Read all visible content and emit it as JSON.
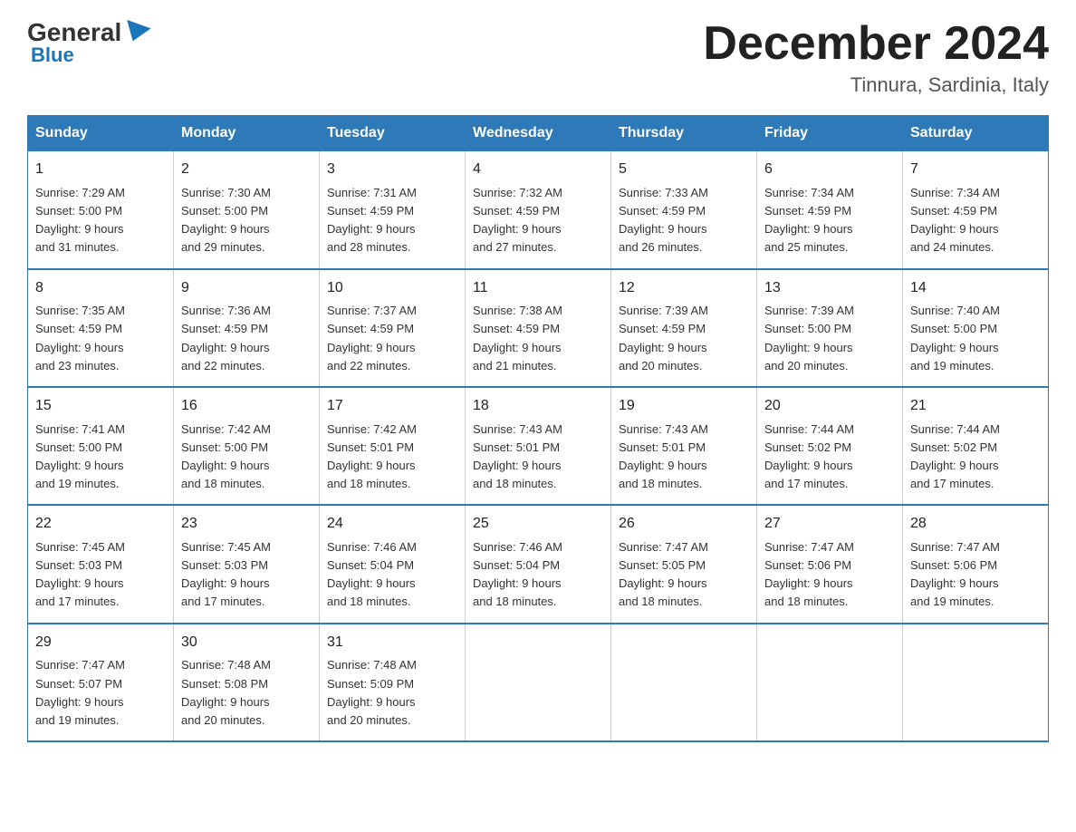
{
  "logo": {
    "general": "General",
    "blue": "Blue"
  },
  "header": {
    "month": "December 2024",
    "location": "Tinnura, Sardinia, Italy"
  },
  "days_of_week": [
    "Sunday",
    "Monday",
    "Tuesday",
    "Wednesday",
    "Thursday",
    "Friday",
    "Saturday"
  ],
  "weeks": [
    [
      {
        "day": "1",
        "sunrise": "7:29 AM",
        "sunset": "5:00 PM",
        "daylight": "9 hours and 31 minutes."
      },
      {
        "day": "2",
        "sunrise": "7:30 AM",
        "sunset": "5:00 PM",
        "daylight": "9 hours and 29 minutes."
      },
      {
        "day": "3",
        "sunrise": "7:31 AM",
        "sunset": "4:59 PM",
        "daylight": "9 hours and 28 minutes."
      },
      {
        "day": "4",
        "sunrise": "7:32 AM",
        "sunset": "4:59 PM",
        "daylight": "9 hours and 27 minutes."
      },
      {
        "day": "5",
        "sunrise": "7:33 AM",
        "sunset": "4:59 PM",
        "daylight": "9 hours and 26 minutes."
      },
      {
        "day": "6",
        "sunrise": "7:34 AM",
        "sunset": "4:59 PM",
        "daylight": "9 hours and 25 minutes."
      },
      {
        "day": "7",
        "sunrise": "7:34 AM",
        "sunset": "4:59 PM",
        "daylight": "9 hours and 24 minutes."
      }
    ],
    [
      {
        "day": "8",
        "sunrise": "7:35 AM",
        "sunset": "4:59 PM",
        "daylight": "9 hours and 23 minutes."
      },
      {
        "day": "9",
        "sunrise": "7:36 AM",
        "sunset": "4:59 PM",
        "daylight": "9 hours and 22 minutes."
      },
      {
        "day": "10",
        "sunrise": "7:37 AM",
        "sunset": "4:59 PM",
        "daylight": "9 hours and 22 minutes."
      },
      {
        "day": "11",
        "sunrise": "7:38 AM",
        "sunset": "4:59 PM",
        "daylight": "9 hours and 21 minutes."
      },
      {
        "day": "12",
        "sunrise": "7:39 AM",
        "sunset": "4:59 PM",
        "daylight": "9 hours and 20 minutes."
      },
      {
        "day": "13",
        "sunrise": "7:39 AM",
        "sunset": "5:00 PM",
        "daylight": "9 hours and 20 minutes."
      },
      {
        "day": "14",
        "sunrise": "7:40 AM",
        "sunset": "5:00 PM",
        "daylight": "9 hours and 19 minutes."
      }
    ],
    [
      {
        "day": "15",
        "sunrise": "7:41 AM",
        "sunset": "5:00 PM",
        "daylight": "9 hours and 19 minutes."
      },
      {
        "day": "16",
        "sunrise": "7:42 AM",
        "sunset": "5:00 PM",
        "daylight": "9 hours and 18 minutes."
      },
      {
        "day": "17",
        "sunrise": "7:42 AM",
        "sunset": "5:01 PM",
        "daylight": "9 hours and 18 minutes."
      },
      {
        "day": "18",
        "sunrise": "7:43 AM",
        "sunset": "5:01 PM",
        "daylight": "9 hours and 18 minutes."
      },
      {
        "day": "19",
        "sunrise": "7:43 AM",
        "sunset": "5:01 PM",
        "daylight": "9 hours and 18 minutes."
      },
      {
        "day": "20",
        "sunrise": "7:44 AM",
        "sunset": "5:02 PM",
        "daylight": "9 hours and 17 minutes."
      },
      {
        "day": "21",
        "sunrise": "7:44 AM",
        "sunset": "5:02 PM",
        "daylight": "9 hours and 17 minutes."
      }
    ],
    [
      {
        "day": "22",
        "sunrise": "7:45 AM",
        "sunset": "5:03 PM",
        "daylight": "9 hours and 17 minutes."
      },
      {
        "day": "23",
        "sunrise": "7:45 AM",
        "sunset": "5:03 PM",
        "daylight": "9 hours and 17 minutes."
      },
      {
        "day": "24",
        "sunrise": "7:46 AM",
        "sunset": "5:04 PM",
        "daylight": "9 hours and 18 minutes."
      },
      {
        "day": "25",
        "sunrise": "7:46 AM",
        "sunset": "5:04 PM",
        "daylight": "9 hours and 18 minutes."
      },
      {
        "day": "26",
        "sunrise": "7:47 AM",
        "sunset": "5:05 PM",
        "daylight": "9 hours and 18 minutes."
      },
      {
        "day": "27",
        "sunrise": "7:47 AM",
        "sunset": "5:06 PM",
        "daylight": "9 hours and 18 minutes."
      },
      {
        "day": "28",
        "sunrise": "7:47 AM",
        "sunset": "5:06 PM",
        "daylight": "9 hours and 19 minutes."
      }
    ],
    [
      {
        "day": "29",
        "sunrise": "7:47 AM",
        "sunset": "5:07 PM",
        "daylight": "9 hours and 19 minutes."
      },
      {
        "day": "30",
        "sunrise": "7:48 AM",
        "sunset": "5:08 PM",
        "daylight": "9 hours and 20 minutes."
      },
      {
        "day": "31",
        "sunrise": "7:48 AM",
        "sunset": "5:09 PM",
        "daylight": "9 hours and 20 minutes."
      },
      null,
      null,
      null,
      null
    ]
  ],
  "labels": {
    "sunrise": "Sunrise:",
    "sunset": "Sunset:",
    "daylight": "Daylight:"
  }
}
